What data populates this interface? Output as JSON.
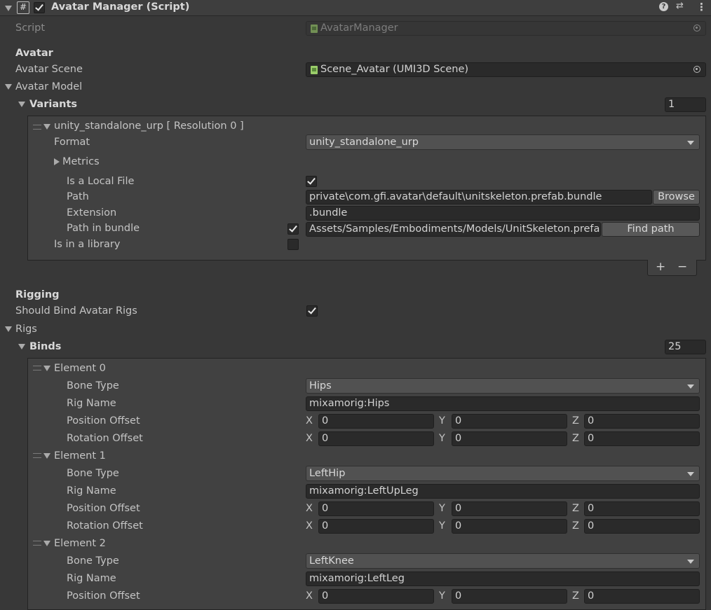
{
  "header": {
    "title": "Avatar Manager (Script)",
    "icon": "script-hash-icon",
    "enabled": true
  },
  "script_field": {
    "label": "Script",
    "value": "AvatarManager"
  },
  "avatar_section": {
    "title": "Avatar",
    "scene_label": "Avatar Scene",
    "scene_value": "Scene_Avatar (UMI3D Scene)",
    "model_label": "Avatar Model",
    "variants_label": "Variants",
    "variants_count": "1"
  },
  "variant": {
    "title": "unity_standalone_urp [ Resolution 0 ]",
    "format_label": "Format",
    "format_value": "unity_standalone_urp",
    "metrics_label": "Metrics",
    "local_label": "Is a Local File",
    "local_checked": true,
    "path_label": "Path",
    "path_value": "private\\com.gfi.avatar\\default\\unitskeleton.prefab.bundle",
    "browse_label": "Browse",
    "ext_label": "Extension",
    "ext_value": ".bundle",
    "bundle_label": "Path in bundle",
    "bundle_checked": true,
    "bundle_value": "Assets/Samples/Embodiments/Models/UnitSkeleton.prefab",
    "find_label": "Find path",
    "library_label": "Is in a library",
    "library_checked": false
  },
  "list_buttons": {
    "add": "+",
    "remove": "−"
  },
  "rigging": {
    "title": "Rigging",
    "bind_label": "Should Bind Avatar Rigs",
    "bind_checked": true,
    "rigs_label": "Rigs",
    "binds_label": "Binds",
    "binds_count": "25"
  },
  "labels": {
    "bone_type": "Bone Type",
    "rig_name": "Rig Name",
    "position_offset": "Position Offset",
    "rotation_offset": "Rotation Offset",
    "x": "X",
    "y": "Y",
    "z": "Z"
  },
  "elements": [
    {
      "title": "Element 0",
      "bone_type": "Hips",
      "rig_name": "mixamorig:Hips",
      "pos": [
        "0",
        "0",
        "0"
      ],
      "rot": [
        "0",
        "0",
        "0"
      ]
    },
    {
      "title": "Element 1",
      "bone_type": "LeftHip",
      "rig_name": "mixamorig:LeftUpLeg",
      "pos": [
        "0",
        "0",
        "0"
      ],
      "rot": [
        "0",
        "0",
        "0"
      ]
    },
    {
      "title": "Element 2",
      "bone_type": "LeftKnee",
      "rig_name": "mixamorig:LeftLeg",
      "pos": [
        "0",
        "0",
        "0"
      ]
    }
  ]
}
